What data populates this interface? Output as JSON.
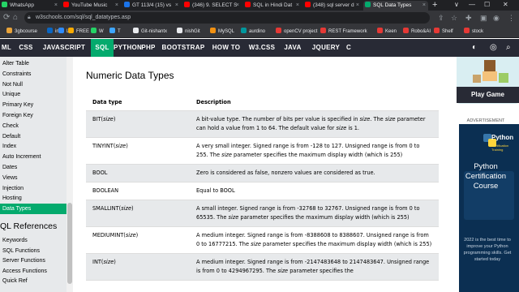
{
  "browser": {
    "tabs": [
      {
        "label": "WhatsApp",
        "favicon_color": "#25d366"
      },
      {
        "label": "YouTube Music",
        "favicon_color": "#ff0000"
      },
      {
        "label": "GT 113/4 (15) vs",
        "favicon_color": "#1a73e8"
      },
      {
        "label": "(346) 9. SELECT S",
        "favicon_color": "#ff0000"
      },
      {
        "label": "SQL in Hindi Dat",
        "favicon_color": "#ff0000"
      },
      {
        "label": "(348) sql server d",
        "favicon_color": "#ff0000"
      },
      {
        "label": "SQL Data Types",
        "favicon_color": "#04aa6d",
        "active": true
      }
    ],
    "new_tab": "+",
    "window_controls": [
      "∨",
      "—",
      "☐",
      "✕"
    ],
    "url": "w3schools.com/sql/sql_datatypes.asp",
    "bookmarks": [
      {
        "label": "3gbcourse",
        "color": "#e8a33a"
      },
      {
        "label": "in",
        "color": "#0a66c2"
      },
      {
        "label": "L",
        "color": "#2d8cff"
      },
      {
        "label": "FREE",
        "color": "#f9ab00"
      },
      {
        "label": "W",
        "color": "#25d366"
      },
      {
        "label": "T",
        "color": "#3ea6ff"
      },
      {
        "label": "Git-nishantx",
        "color": "#e8eaed"
      },
      {
        "label": "nishGit",
        "color": "#e8eaed"
      },
      {
        "label": "MySQL",
        "color": "#f29111"
      },
      {
        "label": "aurdino",
        "color": "#00979d"
      },
      {
        "label": "openCV project",
        "color": "#e53935"
      },
      {
        "label": "REST Framework",
        "color": "#e53935"
      },
      {
        "label": "Keen",
        "color": "#e53935"
      },
      {
        "label": "Robo&AI",
        "color": "#e53935"
      },
      {
        "label": "Shelf",
        "color": "#e53935"
      },
      {
        "label": "stock",
        "color": "#e53935"
      }
    ]
  },
  "nav": {
    "links": [
      "ML",
      "CSS",
      "JAVASCRIPT",
      "SQL",
      "PYTHON",
      "PHP",
      "BOOTSTRAP",
      "HOW TO",
      "W3.CSS",
      "JAVA",
      "JQUERY",
      "C"
    ],
    "active": "SQL",
    "accent": "#04aa6d"
  },
  "sidebar": {
    "items": [
      "Alter Table",
      "Constraints",
      "Not Null",
      "Unique",
      "Primary Key",
      "Foreign Key",
      "Check",
      "Default",
      "Index",
      "Auto Increment",
      "Dates",
      "Views",
      "Injection",
      "Hosting",
      "Data Types"
    ],
    "active": "Data Types",
    "heading": "QL References",
    "ref_items": [
      "Keywords",
      "SQL Functions",
      "Server Functions",
      "Access Functions",
      "Quick Ref"
    ]
  },
  "main": {
    "title": "Numeric Data Types",
    "columns": [
      "Data type",
      "Description"
    ],
    "rows": [
      {
        "type_prefix": "BIT(",
        "type_param": "size",
        "type_suffix": ")",
        "parts": [
          {
            "t": "A bit-value type. The number of bits per value is specified in "
          },
          {
            "t": "size",
            "i": true
          },
          {
            "t": ". The "
          },
          {
            "t": "size",
            "i": true
          },
          {
            "t": " parameter can hold a value from 1 to 64. The default value for "
          },
          {
            "t": "size",
            "i": true
          },
          {
            "t": " is 1."
          }
        ]
      },
      {
        "type_prefix": "TINYINT(",
        "type_param": "size",
        "type_suffix": ")",
        "parts": [
          {
            "t": "A very small integer. Signed range is from -128 to 127. Unsigned range is from 0 to 255. The "
          },
          {
            "t": "size",
            "i": true
          },
          {
            "t": " parameter specifies the maximum display width (which is 255)"
          }
        ]
      },
      {
        "type_prefix": "BOOL",
        "type_param": "",
        "type_suffix": "",
        "parts": [
          {
            "t": "Zero is considered as false, nonzero values are considered as true."
          }
        ]
      },
      {
        "type_prefix": "BOOLEAN",
        "type_param": "",
        "type_suffix": "",
        "parts": [
          {
            "t": "Equal to BOOL"
          }
        ]
      },
      {
        "type_prefix": "SMALLINT(",
        "type_param": "size",
        "type_suffix": ")",
        "parts": [
          {
            "t": "A small integer. Signed range is from -32768 to 32767. Unsigned range is from 0 to 65535. The "
          },
          {
            "t": "size",
            "i": true
          },
          {
            "t": " parameter specifies the maximum display width (which is 255)"
          }
        ]
      },
      {
        "type_prefix": "MEDIUMINT(",
        "type_param": "size",
        "type_suffix": ")",
        "parts": [
          {
            "t": "A medium integer. Signed range is from -8388608 to 8388607. Unsigned range is from 0 to 16777215. The "
          },
          {
            "t": "size",
            "i": true
          },
          {
            "t": " parameter specifies the maximum display width (which is 255)"
          }
        ]
      },
      {
        "type_prefix": "INT(",
        "type_param": "size",
        "type_suffix": ")",
        "parts": [
          {
            "t": "A medium integer. Signed range is from -2147483648 to 2147483647. Unsigned range is from 0 to 4294967295. The "
          },
          {
            "t": "size",
            "i": true
          },
          {
            "t": " parameter specifies the"
          }
        ]
      }
    ]
  },
  "right": {
    "play_label": "Play Game",
    "ad_label": "ADVERTISEMENT",
    "ad_brand": "Python",
    "ad_brand_sub": "Certification Training",
    "ad_title": "Python Certification Course",
    "ad_text": "2022 is the best time to improve your Python programming skills. Get started today"
  }
}
